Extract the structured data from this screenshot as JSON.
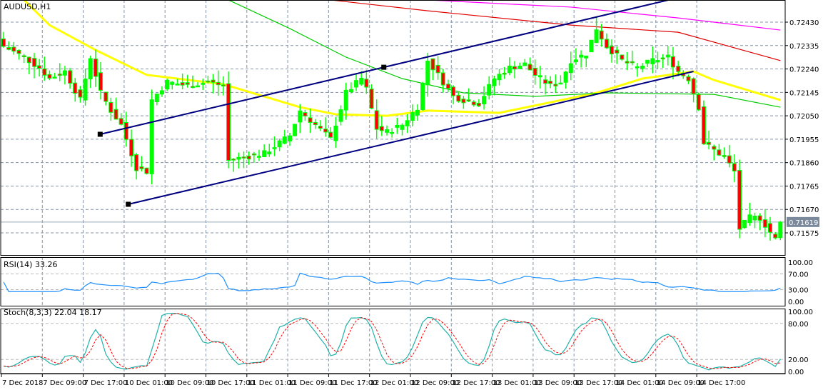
{
  "chart_data": {
    "type": "candlestick",
    "title": "AUDUSD,H1",
    "symbol": "AUDUSD",
    "timeframe": "H1",
    "current_price": "0.71619",
    "price_ticks": [
      "0.72430",
      "0.72335",
      "0.72240",
      "0.72145",
      "0.72050",
      "0.71955",
      "0.71860",
      "0.71765",
      "0.71670",
      "0.71575"
    ],
    "ylim": [
      0.7152,
      0.7252
    ],
    "time_ticks": [
      "7 Dec 2018",
      "7 Dec 09:00",
      "7 Dec 17:00",
      "10 Dec 01:00",
      "10 Dec 09:00",
      "10 Dec 17:00",
      "11 Dec 01:00",
      "11 Dec 09:00",
      "11 Dec 17:00",
      "12 Dec 01:00",
      "12 Dec 09:00",
      "12 Dec 17:00",
      "13 Dec 01:00",
      "13 Dec 09:00",
      "13 Dec 17:00",
      "14 Dec 01:00",
      "14 Dec 09:00",
      "14 Dec 17:00"
    ],
    "bars_count": 153,
    "close_path": [
      [
        0,
        0.72332
      ],
      [
        4,
        0.72288
      ],
      [
        7,
        0.72245
      ],
      [
        9,
        0.72201
      ],
      [
        12,
        0.7223
      ],
      [
        15,
        0.72114
      ],
      [
        17,
        0.72288
      ],
      [
        19,
        0.72143
      ],
      [
        21,
        0.72071
      ],
      [
        23,
        0.72013
      ],
      [
        26,
        0.71839
      ],
      [
        28,
        0.71824
      ],
      [
        29,
        0.72114
      ],
      [
        32,
        0.72187
      ],
      [
        36,
        0.72172
      ],
      [
        40,
        0.72187
      ],
      [
        43,
        0.72172
      ],
      [
        44,
        0.71868
      ],
      [
        47,
        0.71882
      ],
      [
        51,
        0.71897
      ],
      [
        56,
        0.71969
      ],
      [
        58,
        0.72071
      ],
      [
        61,
        0.72013
      ],
      [
        64,
        0.71955
      ],
      [
        67,
        0.72143
      ],
      [
        70,
        0.72201
      ],
      [
        71,
        0.72158
      ],
      [
        73,
        0.71998
      ],
      [
        75,
        0.71984
      ],
      [
        78,
        0.72013
      ],
      [
        81,
        0.72085
      ],
      [
        83,
        0.72274
      ],
      [
        85,
        0.72216
      ],
      [
        88,
        0.72129
      ],
      [
        90,
        0.72114
      ],
      [
        93,
        0.721
      ],
      [
        96,
        0.72201
      ],
      [
        99,
        0.72245
      ],
      [
        102,
        0.72259
      ],
      [
        104,
        0.72216
      ],
      [
        107,
        0.72172
      ],
      [
        109,
        0.72187
      ],
      [
        111,
        0.72274
      ],
      [
        114,
        0.72302
      ],
      [
        116,
        0.72404
      ],
      [
        118,
        0.72332
      ],
      [
        121,
        0.72274
      ],
      [
        124,
        0.72245
      ],
      [
        127,
        0.72274
      ],
      [
        130,
        0.72288
      ],
      [
        132,
        0.7223
      ],
      [
        134,
        0.72201
      ],
      [
        136,
        0.72085
      ],
      [
        137,
        0.7194
      ],
      [
        139,
        0.71911
      ],
      [
        141,
        0.71882
      ],
      [
        143,
        0.71824
      ],
      [
        144,
        0.71592
      ],
      [
        146,
        0.71636
      ],
      [
        148,
        0.71636
      ],
      [
        151,
        0.71549
      ],
      [
        152,
        0.71619
      ]
    ],
    "moving_averages": [
      {
        "color": "#ffff00",
        "points": [
          [
            4,
            0.7252
          ],
          [
            9,
            0.72418
          ],
          [
            18,
            0.72317
          ],
          [
            28,
            0.72216
          ],
          [
            43,
            0.72178
          ],
          [
            58,
            0.72085
          ],
          [
            65,
            0.72056
          ],
          [
            75,
            0.7205
          ],
          [
            83,
            0.72071
          ],
          [
            97,
            0.72062
          ],
          [
            116,
            0.72143
          ],
          [
            125,
            0.72201
          ],
          [
            135,
            0.7223
          ],
          [
            139,
            0.72195
          ],
          [
            152,
            0.72114
          ]
        ]
      },
      {
        "color": "#00cc00",
        "points": [
          [
            44,
            0.7252
          ],
          [
            56,
            0.72404
          ],
          [
            67,
            0.72288
          ],
          [
            78,
            0.72201
          ],
          [
            90,
            0.72143
          ],
          [
            104,
            0.72129
          ],
          [
            118,
            0.72143
          ],
          [
            139,
            0.72137
          ],
          [
            152,
            0.72085
          ]
        ]
      },
      {
        "color": "#e00000",
        "points": [
          [
            64,
            0.7252
          ],
          [
            83,
            0.72476
          ],
          [
            111,
            0.72418
          ],
          [
            132,
            0.72389
          ],
          [
            152,
            0.72274
          ]
        ]
      },
      {
        "color": "#ff00ff",
        "points": [
          [
            83,
            0.7252
          ],
          [
            111,
            0.72491
          ],
          [
            132,
            0.72447
          ],
          [
            152,
            0.72398
          ]
        ]
      }
    ],
    "trendlines": [
      {
        "name": "channel-upper",
        "color": "#000080",
        "p1": [
          18.9,
          0.71975
        ],
        "p2": [
          74.4,
          0.72247
        ],
        "extend_right": true
      },
      {
        "name": "channel-lower",
        "color": "#000080",
        "p1": [
          24.4,
          0.71691
        ],
        "p2": [
          135,
          0.7223
        ],
        "extend_right": false
      }
    ],
    "rsi": {
      "label": "RSI(14) 33.26",
      "ticks": [
        "100.00",
        "70.00",
        "30.00",
        "0.00"
      ],
      "color": "#1e90ff"
    },
    "stoch": {
      "label": "Stoch(8,3,3) 22.04 18.17",
      "ticks": [
        "100.00",
        "80.00",
        "20.00",
        "0.00"
      ],
      "main_color": "#20b2aa",
      "signal_color": "#ff0000"
    },
    "colors": {
      "bull": "#00ff00",
      "bear": "#ff0000",
      "grid": "#8494a8",
      "price_tag": "#7a8a9c"
    }
  }
}
